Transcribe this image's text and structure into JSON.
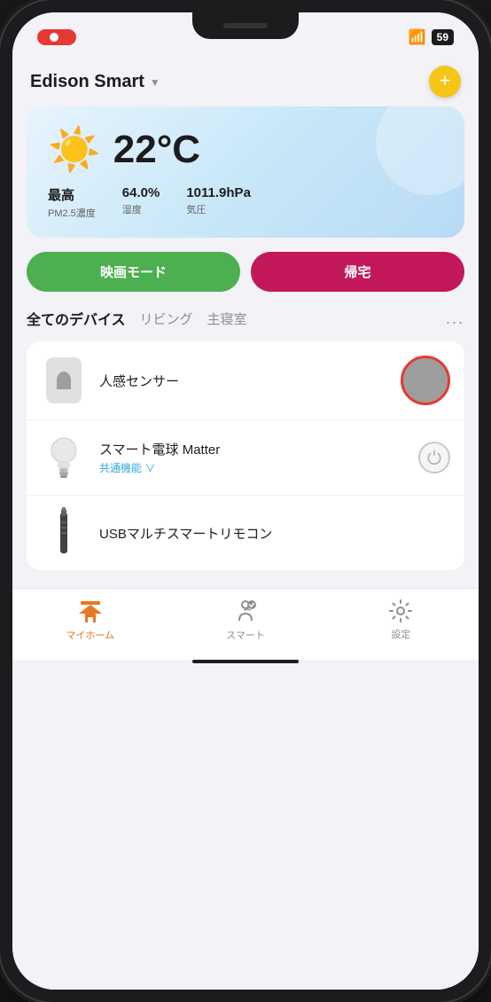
{
  "phone": {
    "status_bar": {
      "record_label": "●",
      "wifi": "wifi",
      "battery": "59"
    }
  },
  "header": {
    "title": "Edison Smart",
    "chevron": "▼",
    "add_btn": "+"
  },
  "weather": {
    "temperature": "22°C",
    "sun_emoji": "☀️",
    "stats": [
      {
        "value": "最高",
        "label": "PM2.5濃度"
      },
      {
        "value": "64.0%",
        "label": "湿度"
      },
      {
        "value": "1011.9hPa",
        "label": "気圧"
      }
    ]
  },
  "mode_buttons": [
    {
      "label": "映画モード",
      "color": "#4caf50"
    },
    {
      "label": "帰宅",
      "color": "#c2185b"
    }
  ],
  "tabs": [
    {
      "label": "全てのデバイス",
      "active": true
    },
    {
      "label": "リビング",
      "active": false
    },
    {
      "label": "主寝室",
      "active": false
    }
  ],
  "tabs_more": "...",
  "devices": [
    {
      "id": "motion-sensor",
      "name": "人感センサー",
      "sub": "",
      "has_toggle_overlay": true,
      "has_power_btn": false
    },
    {
      "id": "smart-bulb",
      "name": "スマート電球 Matter",
      "sub": "共通機能 ∨",
      "has_toggle_overlay": false,
      "has_power_btn": true
    },
    {
      "id": "usb-remote",
      "name": "USBマルチスマートリモコン",
      "sub": "",
      "has_toggle_overlay": false,
      "has_power_btn": false
    }
  ],
  "nav": [
    {
      "id": "myhome",
      "label": "マイホーム",
      "active": true
    },
    {
      "id": "smart",
      "label": "スマート",
      "active": false
    },
    {
      "id": "settings",
      "label": "設定",
      "active": false
    }
  ]
}
